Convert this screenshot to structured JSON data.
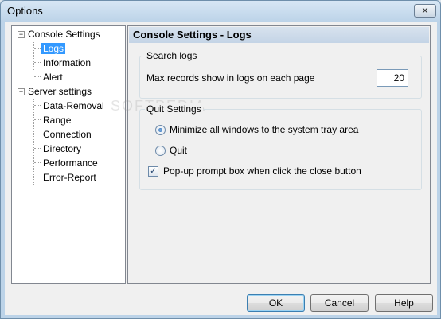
{
  "window": {
    "title": "Options",
    "close_glyph": "✕"
  },
  "tree": {
    "items": [
      {
        "label": "Console Settings",
        "expander": "−"
      },
      {
        "label": "Logs"
      },
      {
        "label": "Information"
      },
      {
        "label": "Alert"
      },
      {
        "label": "Server settings",
        "expander": "−"
      },
      {
        "label": "Data-Removal"
      },
      {
        "label": "Range"
      },
      {
        "label": "Connection"
      },
      {
        "label": "Directory"
      },
      {
        "label": "Performance"
      },
      {
        "label": "Error-Report"
      }
    ]
  },
  "panel": {
    "title": "Console Settings - Logs",
    "search_group": {
      "title": "Search logs",
      "max_records_label": "Max records show in logs on each page",
      "max_records_value": "20"
    },
    "quit_group": {
      "title": "Quit Settings",
      "minimize_label": "Minimize all windows to the system tray area",
      "quit_label": "Quit",
      "popup_label": "Pop-up prompt box when click the close button",
      "checkmark": "✓"
    }
  },
  "buttons": {
    "ok": "OK",
    "cancel": "Cancel",
    "help": "Help"
  },
  "watermark": "SOFTPEDIA"
}
